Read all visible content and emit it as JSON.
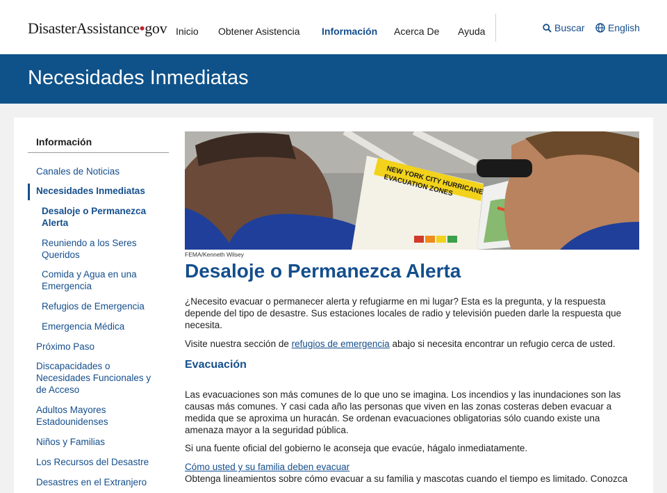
{
  "header": {
    "logo": {
      "part1": "Disaster",
      "part2": "Assistance",
      "dot": "•",
      "part3": "gov"
    },
    "nav": [
      "Inicio",
      "Obtener Asistencia",
      "Información",
      "Acerca De",
      "Ayuda"
    ],
    "search_label": "Buscar",
    "language_label": "English"
  },
  "banner": {
    "title": "Necesidades Inmediatas"
  },
  "sidebar": {
    "heading": "Información",
    "items": [
      "Canales de Noticias",
      "Necesidades Inmediatas",
      "Desaloje o Permanezca Alerta",
      "Reuniendo a los Seres Queridos",
      "Comida y Agua en una Emergencia",
      "Refugios de Emergencia",
      "Emergencia Médica",
      "Próximo Paso",
      "Discapacidades o Necesidades Funcionales y de Acceso",
      "Adultos Mayores Estadounidenses",
      "Niños y Familias",
      "Los Recursos del Desastre",
      "Desastres en el Extranjero"
    ]
  },
  "main": {
    "image": {
      "caption": "FEMA/Kenneth Wilsey",
      "map_title_line1": "NEW YORK CITY HURRICANE",
      "map_title_line2": "EVACUATION ZONES"
    },
    "title": "Desaloje o Permanezca Alerta",
    "intro": "¿Necesito evacuar o permanecer alerta y refugiarme en mi lugar? Esta es la pregunta, y la respuesta depende del tipo de desastre. Sus estaciones locales de radio y televisión pueden darle la respuesta que necesita.",
    "visit_prefix": "Visite nuestra sección de ",
    "visit_link": "refugios de emergencia",
    "visit_suffix": " abajo si necesita encontrar un refugio cerca de usted.",
    "section_title": "Evacuación",
    "evac_para": "Las evacuaciones son más comunes de lo que uno se imagina. Los incendios y las inundaciones son las causas más comunes. Y casi cada año las personas que viven en las zonas costeras deben evacuar a medida que se aproxima un huracán. Se ordenan evacuaciones obligatorias sólo cuando existe una amenaza mayor a la seguridad pública.",
    "official_para": "Si una fuente oficial del gobierno le aconseja que evacúe, hágalo inmediatamente.",
    "family_link": "Cómo usted y su familia deben evacuar",
    "family_para": "Obtenga lineamientos sobre cómo evacuar a su familia y mascotas cuando el tiempo es limitado. Conozca"
  },
  "colors": {
    "brand_blue": "#0f5289",
    "link_blue": "#144e8c",
    "logo_dot_red": "#c0262d"
  }
}
